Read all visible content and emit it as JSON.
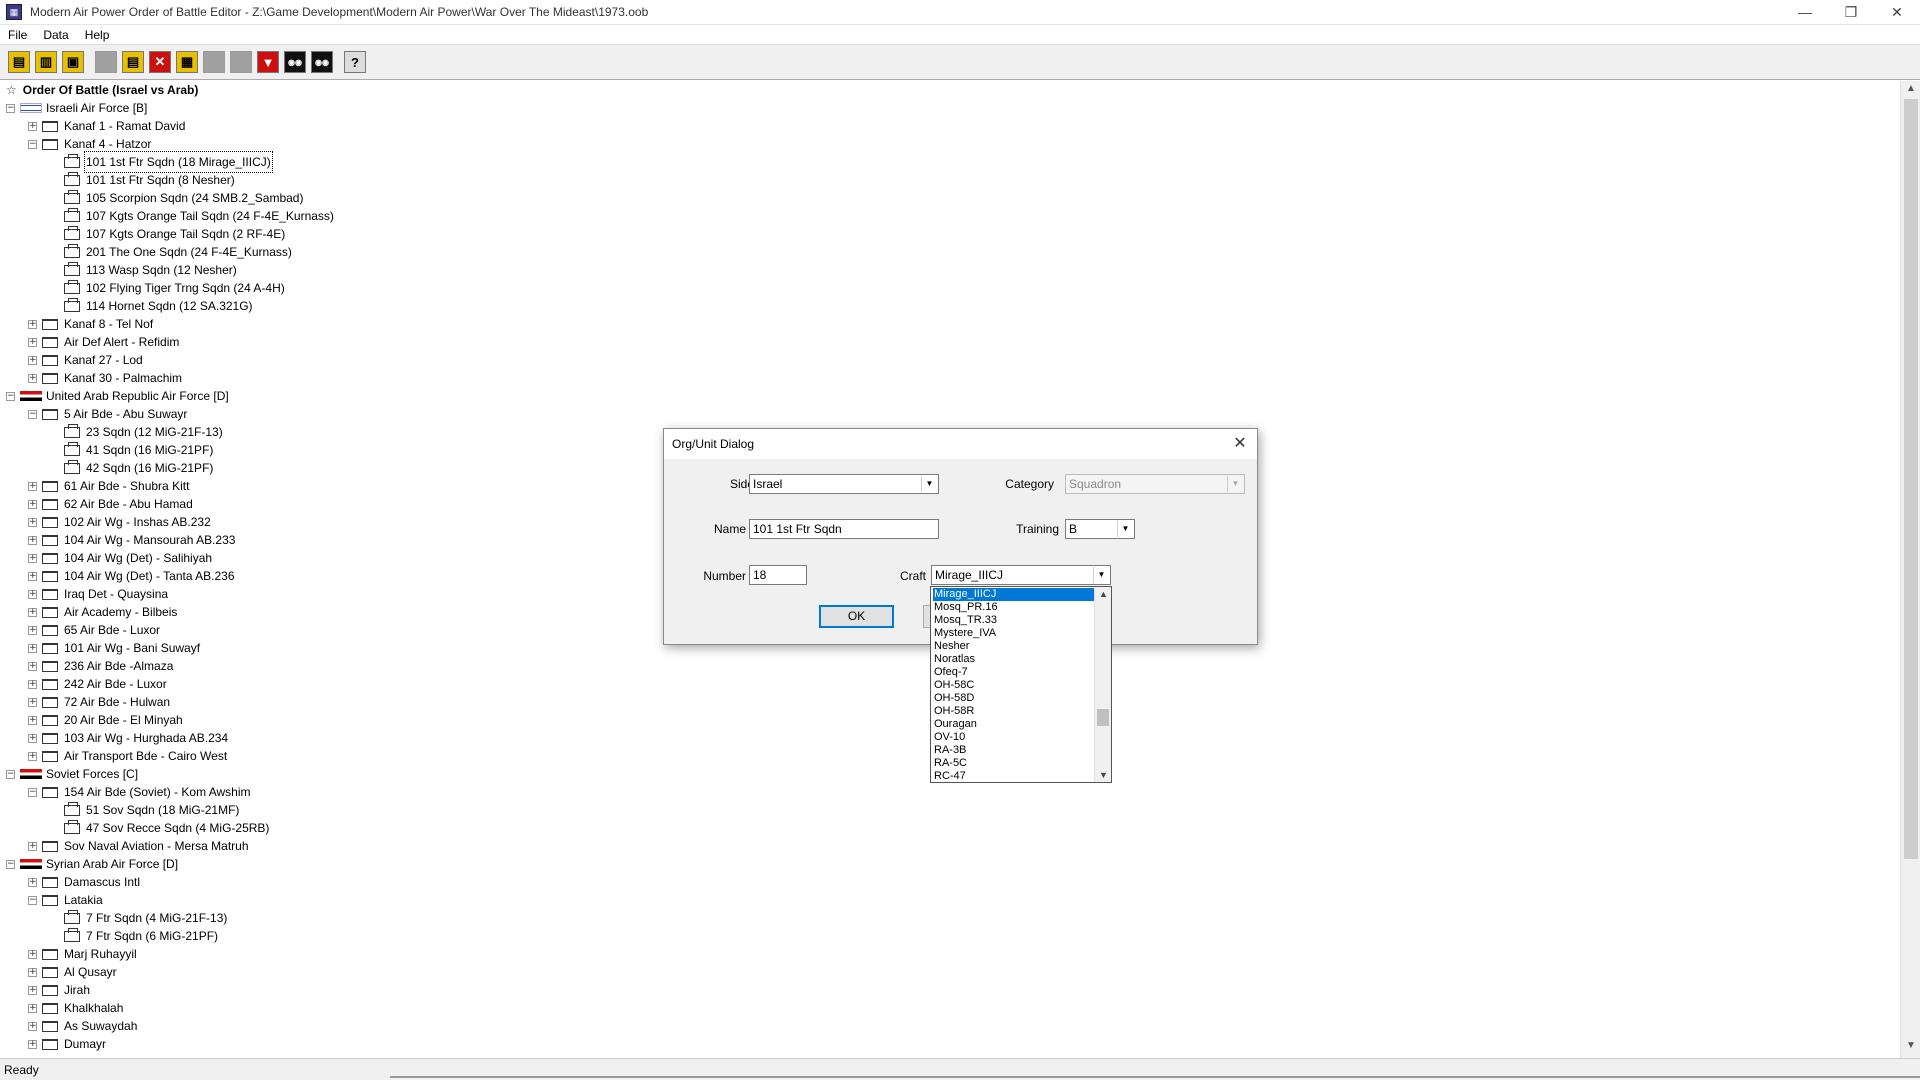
{
  "window": {
    "title": "Modern Air Power Order of Battle Editor - Z:\\Game Development\\Modern Air Power\\War Over The Mideast\\1973.oob",
    "minimize": "—",
    "maximize": "❐",
    "close": "✕"
  },
  "menu": [
    "File",
    "Data",
    "Help"
  ],
  "toolbar": {
    "icons": [
      "new-file-icon",
      "open-file-icon",
      "save-icon",
      "blank-icon",
      "properties-icon",
      "delete-icon",
      "edit-icon",
      "blank-icon-2",
      "blank-icon-3",
      "move-down-icon",
      "view-icon",
      "view-icon-2",
      "help-icon"
    ],
    "glyphs": [
      "▤",
      "▥",
      "▣",
      "",
      "▤",
      "✕",
      "▦",
      "",
      "",
      "▼",
      "◉◉",
      "◉◉",
      "?"
    ]
  },
  "tree": {
    "root": "Order Of Battle (Israel vs Arab)",
    "nodes": [
      {
        "label": "Israeli Air Force [B]",
        "level": 1,
        "kind": "side-il",
        "exp": "−"
      },
      {
        "label": "Kanaf 1 - Ramat David",
        "level": 2,
        "kind": "base",
        "exp": "+"
      },
      {
        "label": "Kanaf 4 - Hatzor",
        "level": 2,
        "kind": "base",
        "exp": "−"
      },
      {
        "label": "101 1st Ftr Sqdn (18 Mirage_IIICJ)",
        "level": 3,
        "kind": "unit",
        "selected": true
      },
      {
        "label": "101 1st Ftr Sqdn (8 Nesher)",
        "level": 3,
        "kind": "unit"
      },
      {
        "label": "105 Scorpion Sqdn (24 SMB.2_Sambad)",
        "level": 3,
        "kind": "unit"
      },
      {
        "label": "107 Kgts Orange Tail Sqdn (24 F-4E_Kurnass)",
        "level": 3,
        "kind": "unit"
      },
      {
        "label": "107 Kgts Orange Tail Sqdn (2 RF-4E)",
        "level": 3,
        "kind": "unit"
      },
      {
        "label": "201 The One Sqdn (24 F-4E_Kurnass)",
        "level": 3,
        "kind": "unit"
      },
      {
        "label": "113 Wasp Sqdn (12 Nesher)",
        "level": 3,
        "kind": "unit"
      },
      {
        "label": "102 Flying Tiger Trng Sqdn (24 A-4H)",
        "level": 3,
        "kind": "unit"
      },
      {
        "label": "114 Hornet Sqdn (12 SA.321G)",
        "level": 3,
        "kind": "unit"
      },
      {
        "label": "Kanaf 8 - Tel Nof",
        "level": 2,
        "kind": "base",
        "exp": "+"
      },
      {
        "label": "Air Def Alert - Refidim",
        "level": 2,
        "kind": "base",
        "exp": "+"
      },
      {
        "label": "Kanaf 27 - Lod",
        "level": 2,
        "kind": "base",
        "exp": "+"
      },
      {
        "label": "Kanaf 30 - Palmachim",
        "level": 2,
        "kind": "base",
        "exp": "+"
      },
      {
        "label": "United Arab Republic Air Force [D]",
        "level": 1,
        "kind": "side-ar",
        "exp": "−"
      },
      {
        "label": "5 Air Bde - Abu Suwayr",
        "level": 2,
        "kind": "base",
        "exp": "−"
      },
      {
        "label": "23 Sqdn (12 MiG-21F-13)",
        "level": 3,
        "kind": "unit"
      },
      {
        "label": "41 Sqdn (16 MiG-21PF)",
        "level": 3,
        "kind": "unit"
      },
      {
        "label": "42 Sqdn (16 MiG-21PF)",
        "level": 3,
        "kind": "unit"
      },
      {
        "label": "61 Air Bde - Shubra Kitt",
        "level": 2,
        "kind": "base",
        "exp": "+"
      },
      {
        "label": "62 Air Bde - Abu Hamad",
        "level": 2,
        "kind": "base",
        "exp": "+"
      },
      {
        "label": "102 Air Wg - Inshas AB.232",
        "level": 2,
        "kind": "base",
        "exp": "+"
      },
      {
        "label": "104 Air Wg - Mansourah AB.233",
        "level": 2,
        "kind": "base",
        "exp": "+"
      },
      {
        "label": "104 Air Wg (Det) - Salihiyah",
        "level": 2,
        "kind": "base",
        "exp": "+"
      },
      {
        "label": "104 Air Wg (Det) - Tanta AB.236",
        "level": 2,
        "kind": "base",
        "exp": "+"
      },
      {
        "label": "Iraq Det - Quaysina",
        "level": 2,
        "kind": "base",
        "exp": "+"
      },
      {
        "label": "Air Academy - Bilbeis",
        "level": 2,
        "kind": "base",
        "exp": "+"
      },
      {
        "label": "65 Air Bde - Luxor",
        "level": 2,
        "kind": "base",
        "exp": "+"
      },
      {
        "label": "101 Air Wg - Bani Suwayf",
        "level": 2,
        "kind": "base",
        "exp": "+"
      },
      {
        "label": "236 Air Bde -Almaza",
        "level": 2,
        "kind": "base",
        "exp": "+"
      },
      {
        "label": "242 Air Bde - Luxor",
        "level": 2,
        "kind": "base",
        "exp": "+"
      },
      {
        "label": "72 Air Bde - Hulwan",
        "level": 2,
        "kind": "base",
        "exp": "+"
      },
      {
        "label": "20 Air Bde - El Minyah",
        "level": 2,
        "kind": "base",
        "exp": "+"
      },
      {
        "label": "103 Air Wg - Hurghada AB.234",
        "level": 2,
        "kind": "base",
        "exp": "+"
      },
      {
        "label": "Air Transport Bde - Cairo West",
        "level": 2,
        "kind": "base",
        "exp": "+"
      },
      {
        "label": "Soviet Forces [C]",
        "level": 1,
        "kind": "side-ar",
        "exp": "−"
      },
      {
        "label": "154 Air Bde (Soviet) - Kom Awshim",
        "level": 2,
        "kind": "base",
        "exp": "−"
      },
      {
        "label": "51 Sov Sqdn (18 MiG-21MF)",
        "level": 3,
        "kind": "unit"
      },
      {
        "label": "47 Sov Recce Sqdn (4 MiG-25RB)",
        "level": 3,
        "kind": "unit"
      },
      {
        "label": "Sov Naval Aviation - Mersa Matruh",
        "level": 2,
        "kind": "base",
        "exp": "+"
      },
      {
        "label": "Syrian Arab Air Force [D]",
        "level": 1,
        "kind": "side-ar",
        "exp": "−"
      },
      {
        "label": "Damascus Intl",
        "level": 2,
        "kind": "base",
        "exp": "+"
      },
      {
        "label": "Latakia",
        "level": 2,
        "kind": "base",
        "exp": "−"
      },
      {
        "label": "7 Ftr Sqdn (4 MiG-21F-13)",
        "level": 3,
        "kind": "unit"
      },
      {
        "label": "7 Ftr Sqdn (6 MiG-21PF)",
        "level": 3,
        "kind": "unit"
      },
      {
        "label": "Marj Ruhayyil",
        "level": 2,
        "kind": "base",
        "exp": "+"
      },
      {
        "label": "Al Qusayr",
        "level": 2,
        "kind": "base",
        "exp": "+"
      },
      {
        "label": "Jirah",
        "level": 2,
        "kind": "base",
        "exp": "+"
      },
      {
        "label": "Khalkhalah",
        "level": 2,
        "kind": "base",
        "exp": "+"
      },
      {
        "label": "As Suwaydah",
        "level": 2,
        "kind": "base",
        "exp": "+"
      },
      {
        "label": "Dumayr",
        "level": 2,
        "kind": "base",
        "exp": "+"
      }
    ]
  },
  "status": {
    "text": "Ready"
  },
  "dialog": {
    "title": "Org/Unit Dialog",
    "close": "✕",
    "side_label": "Side",
    "side_value": "Israel",
    "category_label": "Category",
    "category_value": "Squadron",
    "name_label": "Name",
    "name_value": "101 1st Ftr Sqdn",
    "training_label": "Training",
    "training_value": "B",
    "number_label": "Number",
    "number_value": "18",
    "craft_label": "Craft",
    "craft_value": "Mirage_IIICJ",
    "ok_label": "OK"
  },
  "craft_options": [
    "Mirage_IIICJ",
    "Mosq_PR.16",
    "Mosq_TR.33",
    "Mystere_IVA",
    "Nesher",
    "Noratlas",
    "Ofeq-7",
    "OH-58C",
    "OH-58D",
    "OH-58R",
    "Ouragan",
    "OV-10",
    "RA-3B",
    "RA-5C",
    "RC-47"
  ],
  "craft_selected_index": 0
}
